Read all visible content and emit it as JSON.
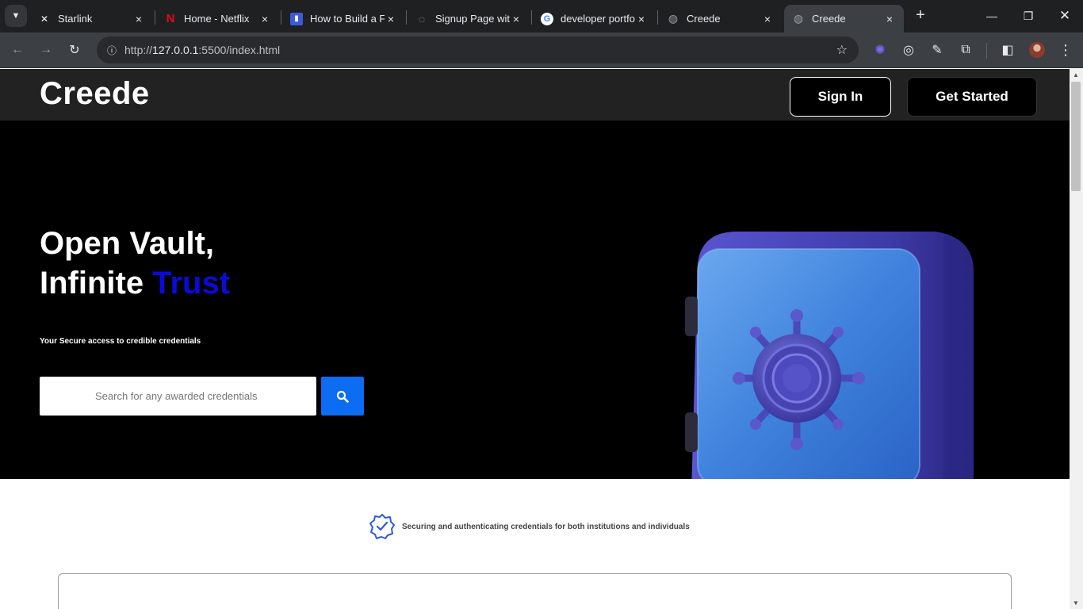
{
  "browser": {
    "tabs": [
      {
        "title": "Starlink",
        "icon": "x-logo-icon"
      },
      {
        "title": "Home - Netflix",
        "icon": "netflix-icon"
      },
      {
        "title": "How to Build a F",
        "icon": "page-icon"
      },
      {
        "title": "Signup Page wit",
        "icon": "loading-icon"
      },
      {
        "title": "developer portfo",
        "icon": "google-icon"
      },
      {
        "title": "Creede",
        "icon": "globe-icon"
      },
      {
        "title": "Creede",
        "icon": "globe-icon",
        "active": true
      }
    ],
    "url_prefix": "http://",
    "url_host": "127.0.0.1",
    "url_path": ":5500/index.html"
  },
  "header": {
    "logo": "Creede",
    "sign_in": "Sign In",
    "get_started": "Get Started"
  },
  "hero": {
    "title_line1": "Open Vault,",
    "title_line2": "Infinite ",
    "title_accent": "Trust",
    "subtitle": "Your Secure access to credible credentials",
    "search_placeholder": "Search for any awarded credentials"
  },
  "tagline": {
    "text": "Securing and authenticating credentials for both institutions and individuals"
  },
  "colors": {
    "accent": "#0b0bd9",
    "search_button": "#0c6cf2",
    "header_bg": "#222222",
    "hero_bg": "#000000"
  }
}
